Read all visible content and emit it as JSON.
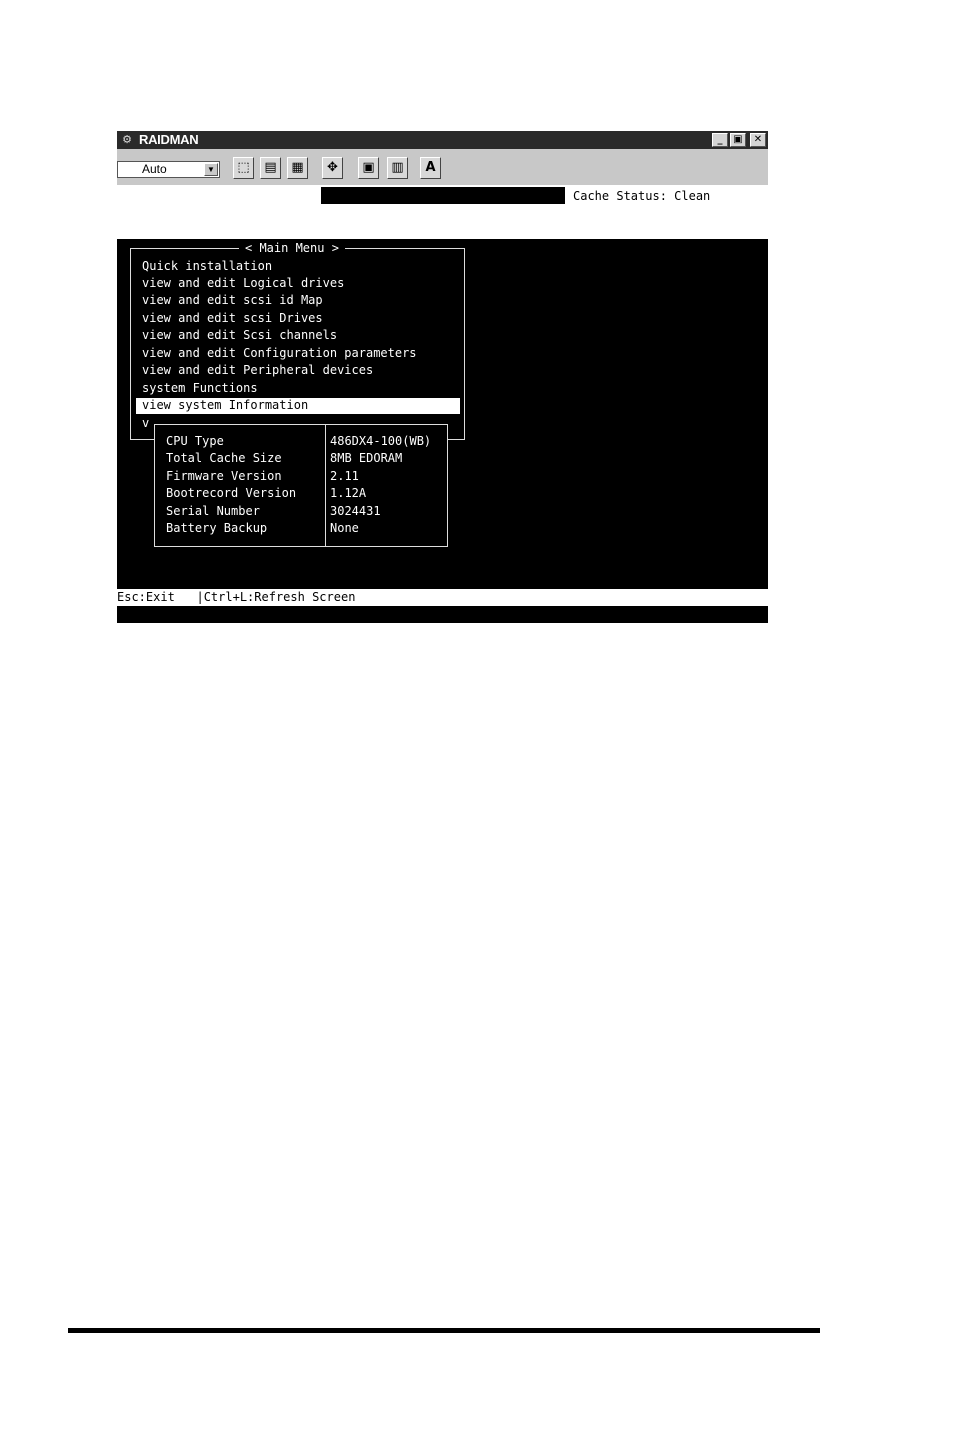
{
  "window": {
    "title": "RAIDMAN",
    "app_icon": "raidman-app-icon",
    "minimize_glyph": "_",
    "maximize_glyph": "▣",
    "close_glyph": "✕"
  },
  "toolbar": {
    "font_select_value": "Auto",
    "buttons": [
      {
        "name": "mark-icon",
        "glyph": "⬚"
      },
      {
        "name": "copy-icon",
        "glyph": "▤"
      },
      {
        "name": "paste-icon",
        "glyph": "▦"
      },
      {
        "name": "fullscreen-icon",
        "glyph": "✥"
      },
      {
        "name": "properties-icon",
        "glyph": "▣"
      },
      {
        "name": "background-icon",
        "glyph": "▥"
      },
      {
        "name": "font-icon",
        "glyph": "A"
      }
    ]
  },
  "status": {
    "cache_status": "Cache Status: Clean"
  },
  "main_menu": {
    "title": "< Main Menu >",
    "items": [
      "Quick installation",
      "view and edit Logical drives",
      "view and edit scsi id Map",
      "view and edit scsi Drives",
      "view and edit Scsi channels",
      "view and edit Configuration parameters",
      "view and edit Peripheral devices",
      "system Functions",
      "view system Information",
      "v"
    ],
    "selected_index": 8
  },
  "system_info": {
    "rows": [
      {
        "label": "CPU Type",
        "value": "486DX4-100(WB)"
      },
      {
        "label": "Total Cache Size",
        "value": "8MB EDORAM"
      },
      {
        "label": "Firmware Version",
        "value": "2.11"
      },
      {
        "label": "Bootrecord Version",
        "value": "1.12A"
      },
      {
        "label": "Serial Number",
        "value": "3024431"
      },
      {
        "label": "Battery Backup",
        "value": "None"
      }
    ]
  },
  "footer_bar": {
    "text": "Esc:Exit   |Ctrl+L:Refresh Screen"
  }
}
